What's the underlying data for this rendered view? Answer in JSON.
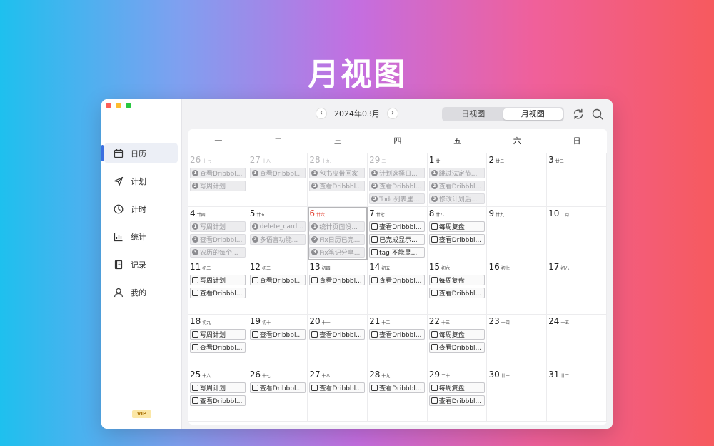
{
  "hero_title": "月视图",
  "sidebar": {
    "items": [
      {
        "label": "日历",
        "icon": "calendar-icon",
        "active": true
      },
      {
        "label": "计划",
        "icon": "send-icon",
        "active": false
      },
      {
        "label": "计时",
        "icon": "clock-icon",
        "active": false
      },
      {
        "label": "统计",
        "icon": "chart-icon",
        "active": false
      },
      {
        "label": "记录",
        "icon": "notebook-icon",
        "active": false
      },
      {
        "label": "我的",
        "icon": "user-icon",
        "active": false
      }
    ],
    "vip_badge": "VIP"
  },
  "toolbar": {
    "month_label": "2024年03月",
    "prev_icon": "chevron-left-icon",
    "next_icon": "chevron-right-icon",
    "day_view_label": "日视图",
    "month_view_label": "月视图",
    "refresh_icon": "refresh-icon",
    "search_icon": "search-icon"
  },
  "colors": {
    "accent": "#3b6fe0",
    "today": "#e34b3c",
    "vip_bg": "#fbe7a6"
  },
  "weekdays": [
    "一",
    "二",
    "三",
    "四",
    "五",
    "六",
    "日"
  ],
  "days": [
    {
      "day": "26",
      "lunar": "十七",
      "other": true,
      "tasks": [
        {
          "text": "查看Dribbbl...",
          "mark": "1",
          "done": true
        },
        {
          "text": "写周计划",
          "mark": "2",
          "done": true
        }
      ]
    },
    {
      "day": "27",
      "lunar": "十八",
      "other": true,
      "tasks": [
        {
          "text": "查看Dribbbl...",
          "mark": "1",
          "done": true
        }
      ]
    },
    {
      "day": "28",
      "lunar": "十九",
      "other": true,
      "tasks": [
        {
          "text": "包书皮带回家",
          "mark": "1",
          "done": true
        },
        {
          "text": "查看Dribbbl...",
          "mark": "2",
          "done": true
        }
      ]
    },
    {
      "day": "29",
      "lunar": "二十",
      "other": true,
      "tasks": [
        {
          "text": "计划选择日...",
          "mark": "1",
          "done": true
        },
        {
          "text": "查看Dribbbl...",
          "mark": "2",
          "done": true
        },
        {
          "text": "Todo列表里...",
          "mark": "3",
          "done": true
        }
      ]
    },
    {
      "day": "1",
      "lunar": "廿一",
      "tasks": [
        {
          "text": "跳过法定节...",
          "mark": "1",
          "done": true
        },
        {
          "text": "查看Dribbbl...",
          "mark": "2",
          "done": true
        },
        {
          "text": "修改计划后...",
          "mark": "3",
          "done": true
        }
      ]
    },
    {
      "day": "2",
      "lunar": "廿二",
      "tasks": []
    },
    {
      "day": "3",
      "lunar": "廿三",
      "tasks": []
    },
    {
      "day": "4",
      "lunar": "廿四",
      "tasks": [
        {
          "text": "写周计划",
          "mark": "1",
          "done": true
        },
        {
          "text": "查看Dribbbl...",
          "mark": "2",
          "done": true
        },
        {
          "text": "农历的每个...",
          "mark": "3",
          "done": true
        }
      ]
    },
    {
      "day": "5",
      "lunar": "廿五",
      "tasks": [
        {
          "text": "delete_card...",
          "mark": "1",
          "done": true
        },
        {
          "text": "多语言功能...",
          "mark": "2",
          "done": true
        }
      ]
    },
    {
      "day": "6",
      "lunar": "廿六",
      "today": true,
      "tasks": [
        {
          "text": "统计页面没...",
          "mark": "1",
          "done": true
        },
        {
          "text": "Fix日历已完...",
          "mark": "2",
          "done": true
        },
        {
          "text": "Fix笔记分享...",
          "mark": "3",
          "done": true
        }
      ]
    },
    {
      "day": "7",
      "lunar": "廿七",
      "tasks": [
        {
          "text": "查看Dribbbl...",
          "mark": "",
          "done": false
        },
        {
          "text": "已完成显示...",
          "mark": "",
          "done": false
        },
        {
          "text": "tag 不能显...",
          "mark": "",
          "done": false
        }
      ]
    },
    {
      "day": "8",
      "lunar": "廿八",
      "tasks": [
        {
          "text": "每周复盘",
          "mark": "",
          "done": false
        },
        {
          "text": "查看Dribbbl...",
          "mark": "",
          "done": false
        }
      ]
    },
    {
      "day": "9",
      "lunar": "廿九",
      "tasks": []
    },
    {
      "day": "10",
      "lunar": "二月",
      "tasks": []
    },
    {
      "day": "11",
      "lunar": "初二",
      "tasks": [
        {
          "text": "写周计划",
          "mark": "",
          "done": false
        },
        {
          "text": "查看Dribbbl...",
          "mark": "",
          "done": false
        }
      ]
    },
    {
      "day": "12",
      "lunar": "初三",
      "tasks": [
        {
          "text": "查看Dribbbl...",
          "mark": "",
          "done": false
        }
      ]
    },
    {
      "day": "13",
      "lunar": "初四",
      "tasks": [
        {
          "text": "查看Dribbbl...",
          "mark": "",
          "done": false
        }
      ]
    },
    {
      "day": "14",
      "lunar": "初五",
      "tasks": [
        {
          "text": "查看Dribbbl...",
          "mark": "",
          "done": false
        }
      ]
    },
    {
      "day": "15",
      "lunar": "初六",
      "tasks": [
        {
          "text": "每周复盘",
          "mark": "",
          "done": false
        },
        {
          "text": "查看Dribbbl...",
          "mark": "",
          "done": false
        }
      ]
    },
    {
      "day": "16",
      "lunar": "初七",
      "tasks": []
    },
    {
      "day": "17",
      "lunar": "初八",
      "tasks": []
    },
    {
      "day": "18",
      "lunar": "初九",
      "tasks": [
        {
          "text": "写周计划",
          "mark": "",
          "done": false
        },
        {
          "text": "查看Dribbbl...",
          "mark": "",
          "done": false
        }
      ]
    },
    {
      "day": "19",
      "lunar": "初十",
      "tasks": [
        {
          "text": "查看Dribbbl...",
          "mark": "",
          "done": false
        }
      ]
    },
    {
      "day": "20",
      "lunar": "十一",
      "tasks": [
        {
          "text": "查看Dribbbl...",
          "mark": "",
          "done": false
        }
      ]
    },
    {
      "day": "21",
      "lunar": "十二",
      "tasks": [
        {
          "text": "查看Dribbbl...",
          "mark": "",
          "done": false
        }
      ]
    },
    {
      "day": "22",
      "lunar": "十三",
      "tasks": [
        {
          "text": "每周复盘",
          "mark": "",
          "done": false
        },
        {
          "text": "查看Dribbbl...",
          "mark": "",
          "done": false
        }
      ]
    },
    {
      "day": "23",
      "lunar": "十四",
      "tasks": []
    },
    {
      "day": "24",
      "lunar": "十五",
      "tasks": []
    },
    {
      "day": "25",
      "lunar": "十六",
      "tasks": [
        {
          "text": "写周计划",
          "mark": "",
          "done": false
        },
        {
          "text": "查看Dribbbl...",
          "mark": "",
          "done": false
        }
      ]
    },
    {
      "day": "26",
      "lunar": "十七",
      "tasks": [
        {
          "text": "查看Dribbbl...",
          "mark": "",
          "done": false
        }
      ]
    },
    {
      "day": "27",
      "lunar": "十八",
      "tasks": [
        {
          "text": "查看Dribbbl...",
          "mark": "",
          "done": false
        }
      ]
    },
    {
      "day": "28",
      "lunar": "十九",
      "tasks": [
        {
          "text": "查看Dribbbl...",
          "mark": "",
          "done": false
        }
      ]
    },
    {
      "day": "29",
      "lunar": "二十",
      "tasks": [
        {
          "text": "每周复盘",
          "mark": "",
          "done": false
        },
        {
          "text": "查看Dribbbl...",
          "mark": "",
          "done": false
        }
      ]
    },
    {
      "day": "30",
      "lunar": "廿一",
      "tasks": []
    },
    {
      "day": "31",
      "lunar": "廿二",
      "tasks": []
    }
  ]
}
